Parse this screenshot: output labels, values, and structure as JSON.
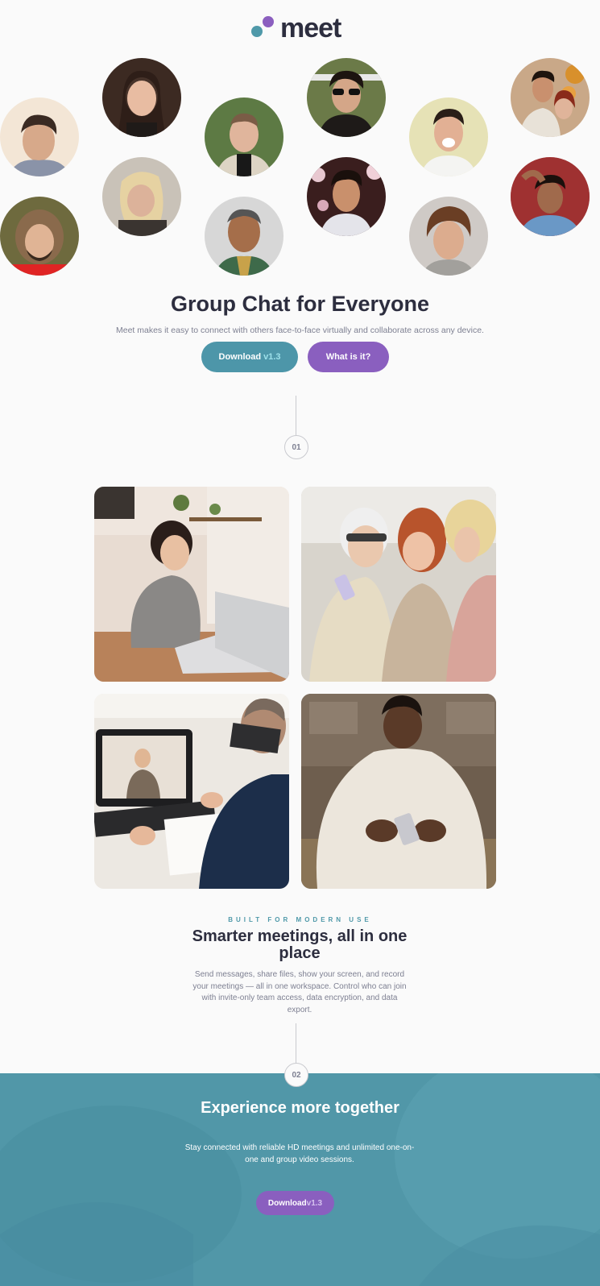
{
  "logo": {
    "text": "meet"
  },
  "hero": {
    "title": "Group Chat for Everyone",
    "subtitle": "Meet makes it easy to connect with others face-to-face virtually and collaborate across any device.",
    "download_label": "Download",
    "download_version": "v1.3",
    "what_label": "What is it?"
  },
  "steps": {
    "one": "01",
    "two": "02"
  },
  "features": {
    "eyebrow": "BUILT FOR MODERN USE",
    "title": "Smarter meetings, all in one place",
    "body": "Send messages, share files, show your screen, and record your meetings — all in one workspace. Control who can join with invite-only team access, data encryption, and data export."
  },
  "band": {
    "title": "Experience more together",
    "body": "Stay connected with reliable HD meetings and unlimited one-on-one and group video sessions.",
    "download_label": "Download",
    "download_version": "v1.3"
  },
  "colors": {
    "teal": "#4d96a9",
    "purple": "#8a5fbf",
    "dark_text": "#2d2e3f",
    "muted_text": "#7e8092"
  }
}
